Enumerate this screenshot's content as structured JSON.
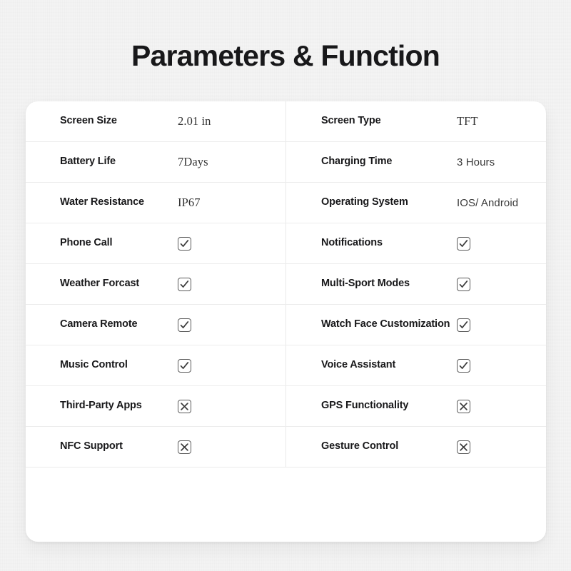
{
  "page": {
    "title": "Parameters & Function",
    "background_color": "#f4f4f4",
    "card_color": "#ffffff",
    "text_color": "#18181a"
  },
  "spec_table": {
    "rows": [
      {
        "left": {
          "label": "Screen Size",
          "value": "2.01 in",
          "value_style": "serif"
        },
        "right": {
          "label": "Screen Type",
          "value": "TFT",
          "value_style": "serif"
        }
      },
      {
        "left": {
          "label": "Battery Life",
          "value": "7Days",
          "value_style": "serif"
        },
        "right": {
          "label": "Charging Time",
          "value": "3 Hours",
          "value_style": "sans"
        }
      },
      {
        "left": {
          "label": "Water Resistance",
          "value": "IP67",
          "value_style": "serif"
        },
        "right": {
          "label": "Operating System",
          "value": "IOS/ Android",
          "value_style": "sans"
        }
      },
      {
        "left": {
          "label": "Phone Call",
          "value": "check",
          "value_style": "mark"
        },
        "right": {
          "label": "Notifications",
          "value": "check",
          "value_style": "mark"
        }
      },
      {
        "left": {
          "label": "Weather Forcast",
          "value": "check",
          "value_style": "mark"
        },
        "right": {
          "label": "Multi-Sport Modes",
          "value": "check",
          "value_style": "mark"
        }
      },
      {
        "left": {
          "label": "Camera Remote",
          "value": "check",
          "value_style": "mark"
        },
        "right": {
          "label": "Watch Face Customization",
          "value": "check",
          "value_style": "mark"
        }
      },
      {
        "left": {
          "label": "Music Control",
          "value": "check",
          "value_style": "mark"
        },
        "right": {
          "label": "Voice Assistant",
          "value": "check",
          "value_style": "mark"
        }
      },
      {
        "left": {
          "label": "Third-Party Apps",
          "value": "cross",
          "value_style": "mark"
        },
        "right": {
          "label": "GPS Functionality",
          "value": "cross",
          "value_style": "mark"
        }
      },
      {
        "left": {
          "label": "NFC Support",
          "value": "cross",
          "value_style": "mark"
        },
        "right": {
          "label": "Gesture Control",
          "value": "cross",
          "value_style": "mark"
        }
      }
    ]
  }
}
